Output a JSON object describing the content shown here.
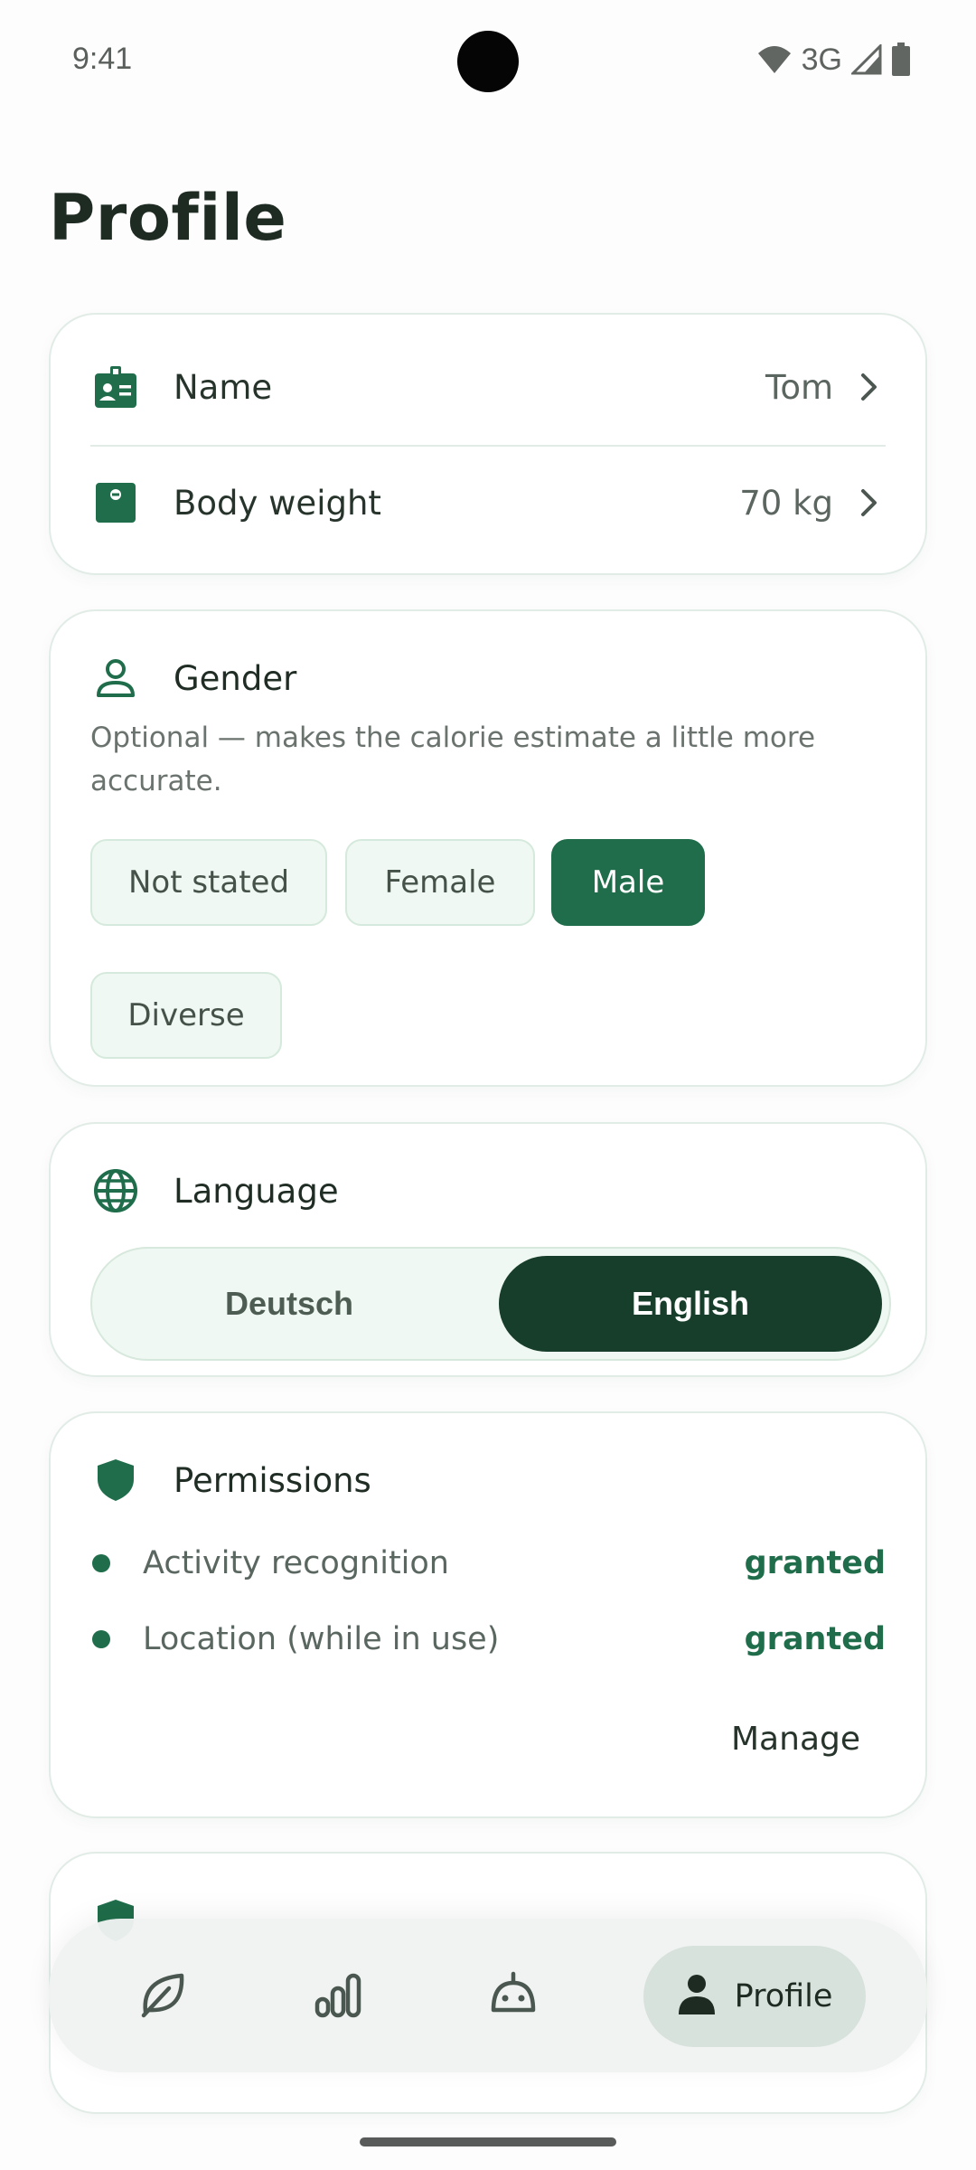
{
  "status_bar": {
    "time": "9:41",
    "network": "3G",
    "icons": [
      "wifi-icon",
      "cell-signal-icon",
      "battery-icon"
    ]
  },
  "page": {
    "title": "Profile"
  },
  "profile_card": {
    "name": {
      "label": "Name",
      "value": "Tom",
      "icon": "id-badge-icon"
    },
    "body_weight": {
      "label": "Body weight",
      "value": "70 kg",
      "icon": "scale-icon"
    }
  },
  "gender": {
    "title": "Gender",
    "description": "Optional — makes the calorie estimate a little more accurate.",
    "options": [
      "Not stated",
      "Female",
      "Male",
      "Diverse"
    ],
    "selected": "Male"
  },
  "language": {
    "title": "Language",
    "options": [
      "Deutsch",
      "English"
    ],
    "selected": "English"
  },
  "permissions": {
    "title": "Permissions",
    "items": [
      {
        "label": "Activity recognition",
        "status": "granted"
      },
      {
        "label": "Location (while in use)",
        "status": "granted"
      }
    ],
    "manage_label": "Manage"
  },
  "bottom_nav": {
    "items": [
      {
        "icon": "leaf-icon",
        "label": ""
      },
      {
        "icon": "bar-chart-icon",
        "label": ""
      },
      {
        "icon": "robot-icon",
        "label": ""
      },
      {
        "icon": "person-icon",
        "label": "Profile"
      }
    ],
    "active": "Profile"
  },
  "colors": {
    "accent": "#1f6d4a",
    "accent_dark": "#173e2b",
    "chip_bg": "#eff8f2",
    "card_border": "#e2ece6"
  }
}
